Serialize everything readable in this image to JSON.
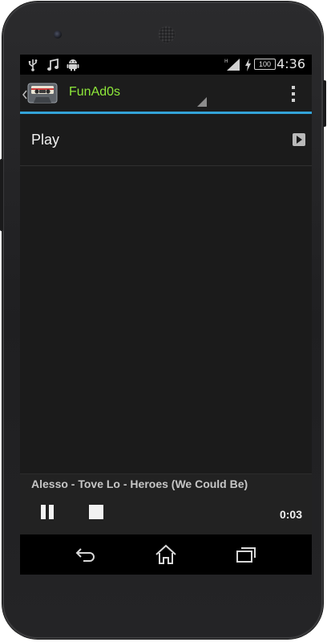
{
  "status_bar": {
    "icons": [
      "usb-icon",
      "music-note-icon",
      "android-icon",
      "signal-icon",
      "charging-icon",
      "battery-icon"
    ],
    "battery_level": "100",
    "time": "4:36"
  },
  "action_bar": {
    "app_title": "FunAd0s",
    "accent_color": "#33a3d8",
    "title_color": "#8ee83a"
  },
  "list": {
    "items": [
      {
        "label": "Play",
        "icon": "play-icon"
      }
    ]
  },
  "player": {
    "track_title": "Alesso - Tove Lo - Heroes (We Could Be)",
    "elapsed": "0:03"
  },
  "nav_bar": {
    "icons": [
      "back-icon",
      "home-icon",
      "recent-apps-icon"
    ]
  }
}
